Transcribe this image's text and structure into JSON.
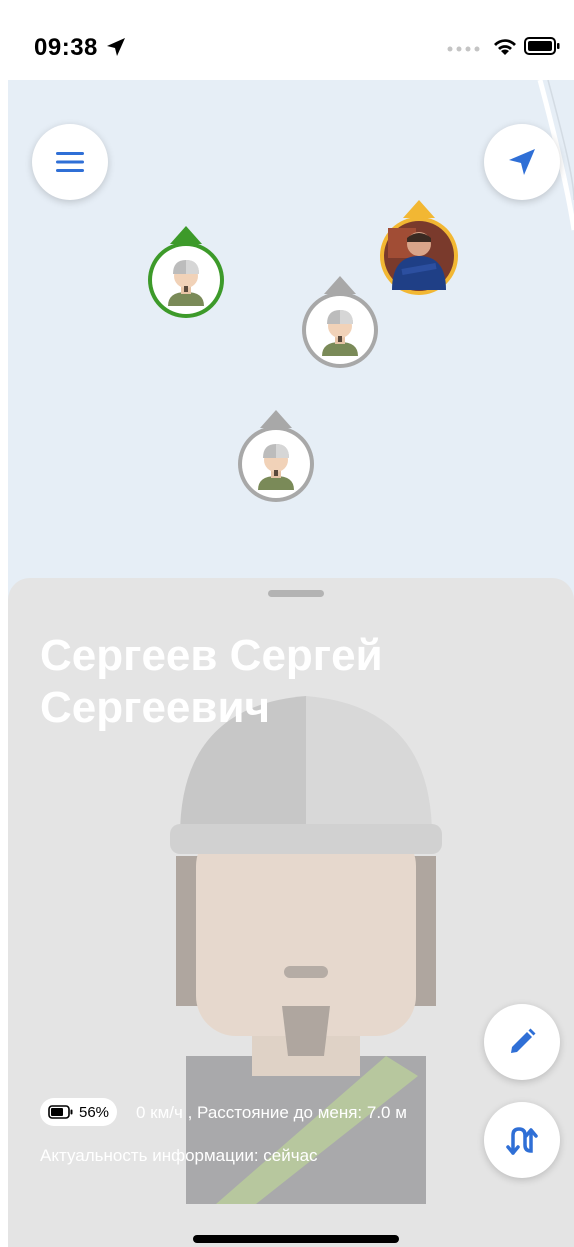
{
  "status_bar": {
    "time": "09:38",
    "icons": [
      "location-arrow-icon",
      "signal-dots-icon",
      "wifi-icon",
      "battery-icon"
    ]
  },
  "map": {
    "buttons": [
      "menu-icon",
      "navigation-arrow-icon"
    ],
    "markers": [
      {
        "name": "worker-marker-green",
        "color": "#3d9a2a"
      },
      {
        "name": "worker-marker-photo-yellow",
        "color": "#f2b733"
      },
      {
        "name": "worker-marker-gray",
        "color": "#a8a8a8"
      },
      {
        "name": "worker-marker-gray-2",
        "color": "#a8a8a8"
      }
    ]
  },
  "sheet": {
    "name_line1": "Сергеев Сергей",
    "name_line2": "Сергеевич",
    "battery": "56%",
    "speed_distance": "0 км/ч , Расстояние до меня: 7.0 м",
    "actuality": "Актуальность информации: сейчас"
  },
  "colors": {
    "accent": "#2f6fd6",
    "map_bg": "#e6eef6",
    "sheet_bg": "#e4e4e4"
  }
}
